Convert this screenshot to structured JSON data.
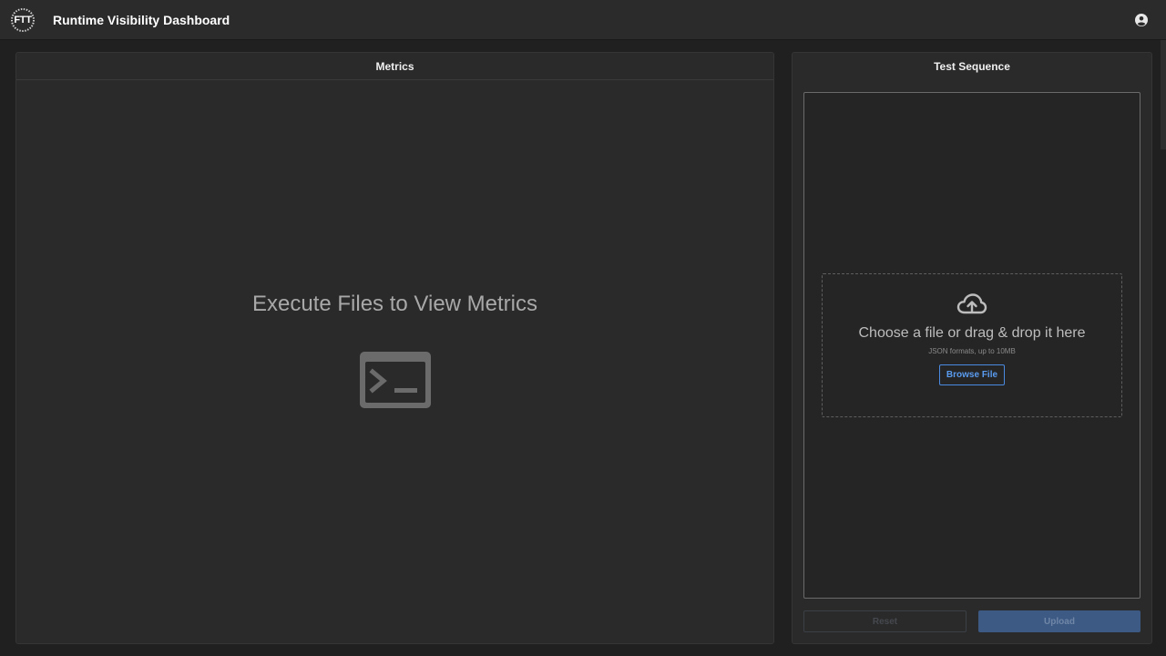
{
  "header": {
    "logo_text": "FTT",
    "title": "Runtime Visibility Dashboard",
    "user_icon": "user-circle-icon"
  },
  "metrics": {
    "title": "Metrics",
    "empty_message": "Execute Files to View Metrics",
    "empty_icon": "terminal-icon"
  },
  "test_sequence": {
    "title": "Test Sequence",
    "dropzone": {
      "icon": "cloud-upload-icon",
      "title": "Choose a file or drag & drop it here",
      "hint": "JSON formats, up to 10MB",
      "browse_label": "Browse File"
    },
    "reset_label": "Reset",
    "upload_label": "Upload"
  },
  "colors": {
    "background": "#202020",
    "panel": "#2a2a2a",
    "accent": "#4a8ae0",
    "upload_button": "#3d5a85"
  }
}
